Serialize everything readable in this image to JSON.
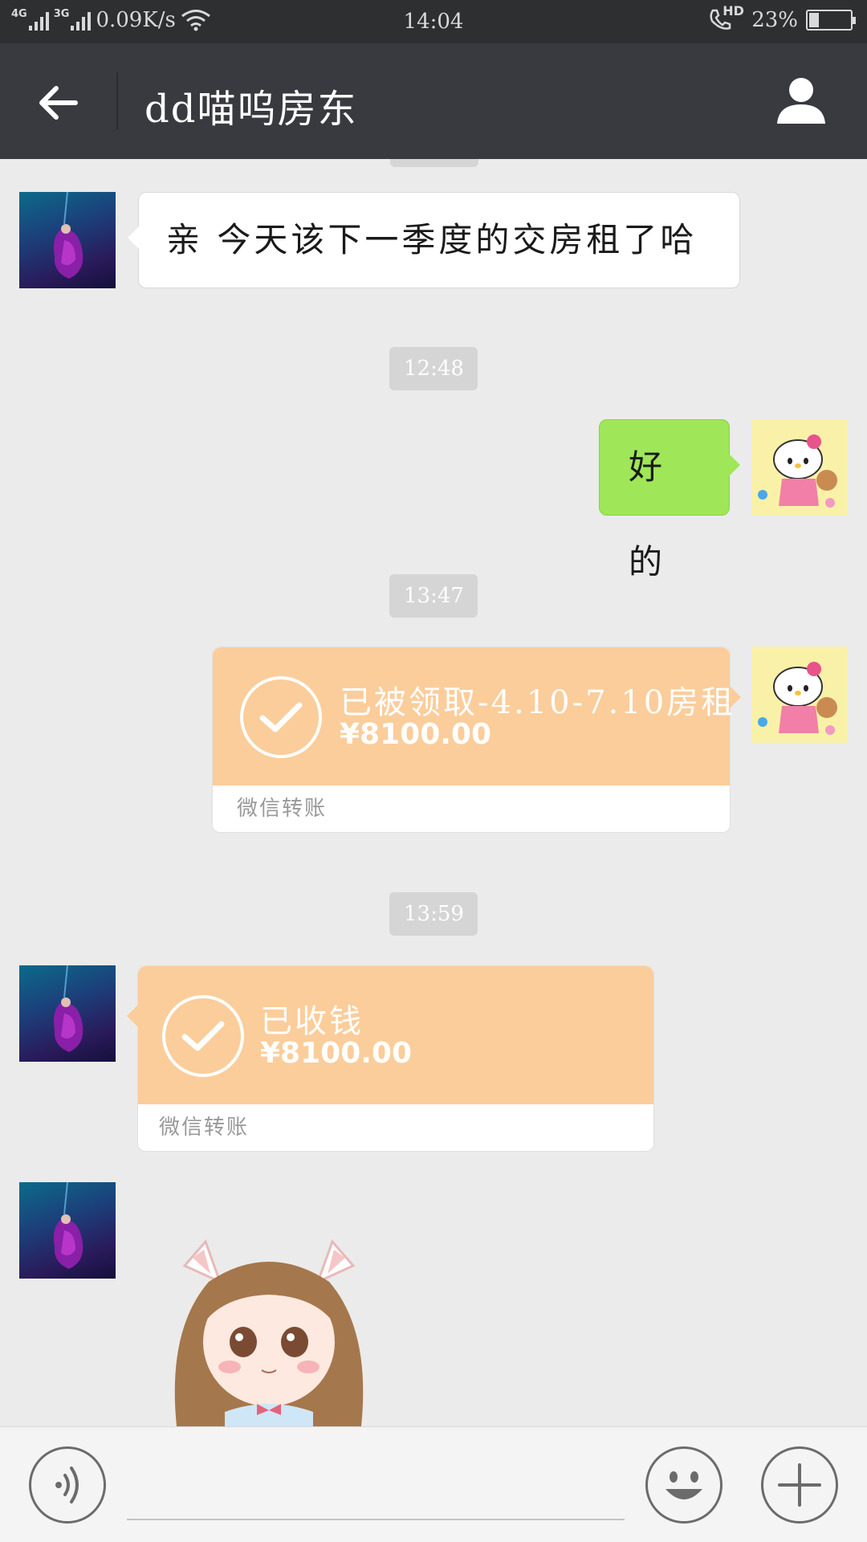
{
  "status_bar": {
    "network_1": "4G",
    "network_2": "3G",
    "speed": "0.09K/s",
    "time": "14:04",
    "call_label": "HD",
    "battery_text": "23%",
    "battery_level": 0.23
  },
  "header": {
    "title": "dd喵呜房东",
    "back_icon": "arrow-left-icon",
    "profile_icon": "person-icon"
  },
  "messages": {
    "msg1_text": "亲 今天该下一季度的交房租了哈",
    "time2": "12:48",
    "msg2_text": "好的",
    "time3": "13:47",
    "transfer1": {
      "title": "已被领取-4.10-7.10房租",
      "amount": "¥8100.00",
      "footer": "微信转账"
    },
    "time4": "13:59",
    "transfer2": {
      "title": "已收钱",
      "amount": "¥8100.00",
      "footer": "微信转账"
    }
  },
  "input_bar": {
    "voice_icon": "voice-icon",
    "emoji_icon": "emoji-icon",
    "plus_icon": "plus-icon",
    "input_value": ""
  },
  "colors": {
    "header_bg": "#393a3f",
    "chat_bg": "#ebebeb",
    "sent_bubble": "#9fe658",
    "transfer_orange": "#fbcd9b"
  }
}
